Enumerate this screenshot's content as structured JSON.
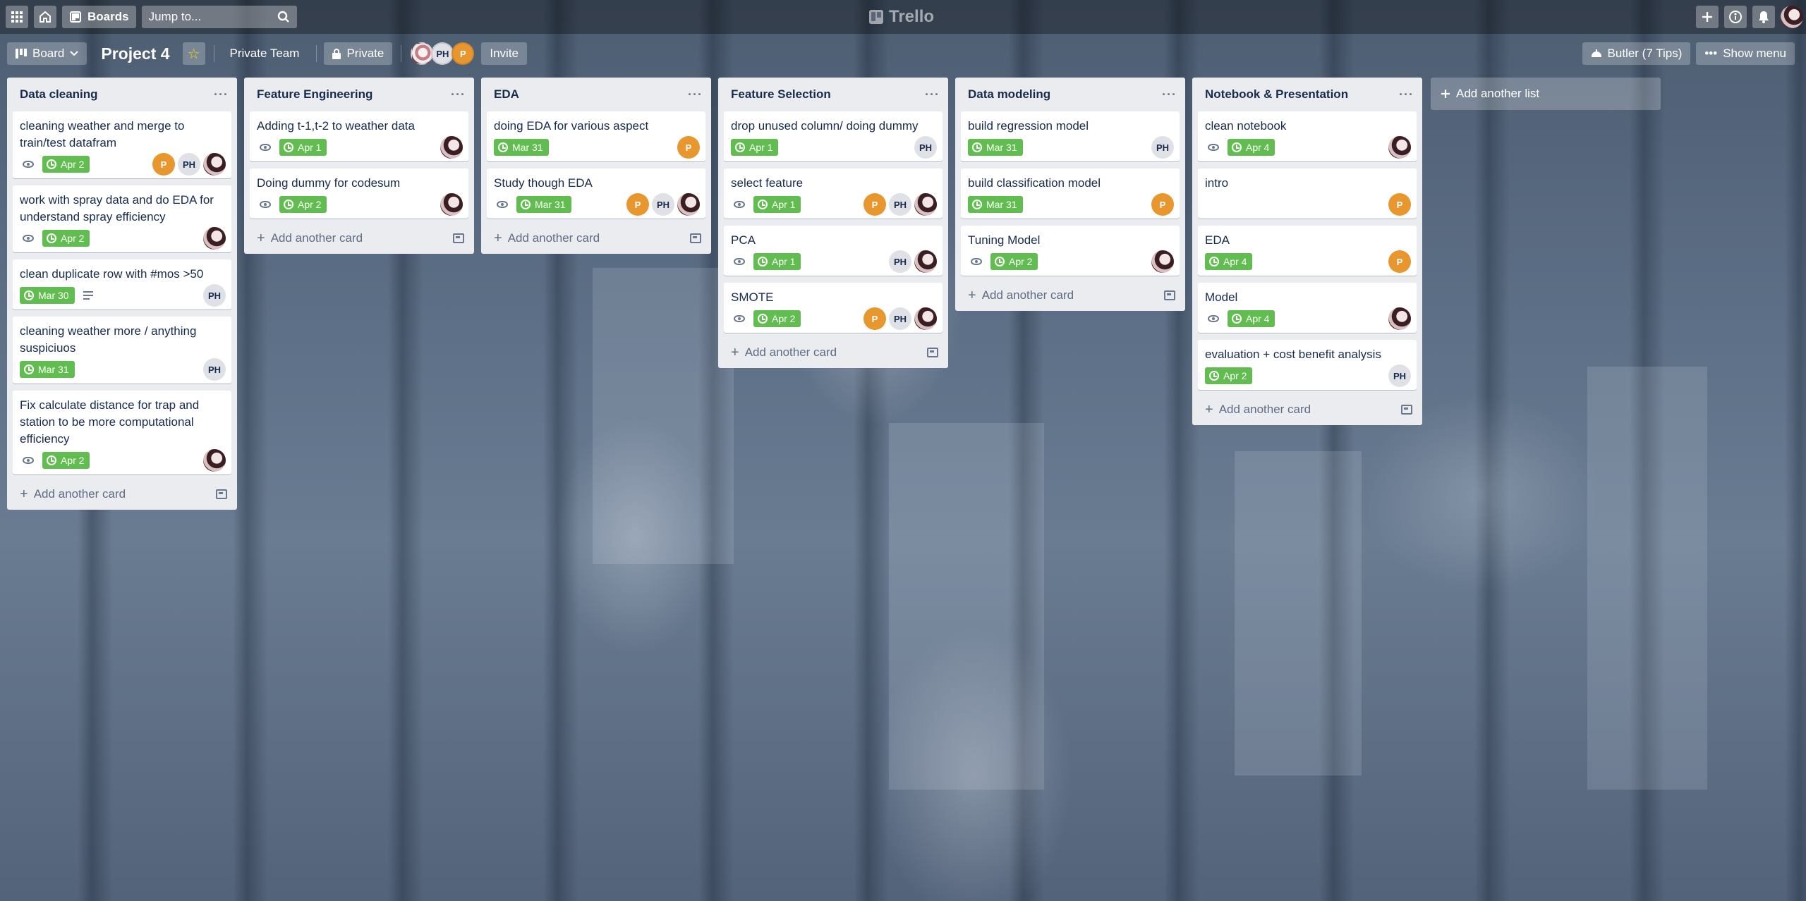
{
  "header": {
    "boards_label": "Boards",
    "search_placeholder": "Jump to...",
    "logo_text": "Trello"
  },
  "board": {
    "view_label": "Board",
    "title": "Project 4",
    "team_label": "Private Team",
    "visibility_label": "Private",
    "invite_label": "Invite",
    "butler_label": "Butler (7 Tips)",
    "menu_label": "Show menu",
    "members": [
      "PH",
      "P"
    ]
  },
  "lists": [
    {
      "title": "Data cleaning",
      "add_card": "Add another card",
      "cards": [
        {
          "title": "cleaning weather and merge to train/test datafram",
          "watch": true,
          "due": "Apr 2",
          "members": [
            "P",
            "PH",
            "img"
          ]
        },
        {
          "title": "work with spray data and do EDA for understand spray efficiency",
          "watch": true,
          "due": "Apr 2",
          "members": [
            "img"
          ]
        },
        {
          "title": "clean duplicate row with #mos >50",
          "watch": false,
          "due": "Mar 30",
          "desc": true,
          "members": [
            "PH"
          ]
        },
        {
          "title": "cleaning weather more / anything suspiciuos",
          "watch": false,
          "due": "Mar 31",
          "members": [
            "PH"
          ]
        },
        {
          "title": "Fix calculate distance for trap and station to be more computational efficiency",
          "watch": true,
          "due": "Apr 2",
          "members": [
            "img"
          ]
        }
      ]
    },
    {
      "title": "Feature Engineering",
      "add_card": "Add another card",
      "cards": [
        {
          "title": "Adding t-1,t-2 to weather data",
          "watch": true,
          "due": "Apr 1",
          "members": [
            "img"
          ]
        },
        {
          "title": "Doing dummy for codesum",
          "watch": true,
          "due": "Apr 2",
          "members": [
            "img"
          ]
        }
      ]
    },
    {
      "title": "EDA",
      "add_card": "Add another card",
      "cards": [
        {
          "title": "doing EDA for various aspect",
          "watch": false,
          "due": "Mar 31",
          "members": [
            "P"
          ]
        },
        {
          "title": "Study though EDA",
          "watch": true,
          "due": "Mar 31",
          "members": [
            "P",
            "PH",
            "img"
          ]
        }
      ]
    },
    {
      "title": "Feature Selection",
      "add_card": "Add another card",
      "cards": [
        {
          "title": "drop unused column/ doing dummy",
          "watch": false,
          "due": "Apr 1",
          "members": [
            "PH"
          ]
        },
        {
          "title": "select feature",
          "watch": true,
          "due": "Apr 1",
          "members": [
            "P",
            "PH",
            "img"
          ]
        },
        {
          "title": "PCA",
          "watch": true,
          "due": "Apr 1",
          "members": [
            "PH",
            "img"
          ]
        },
        {
          "title": "SMOTE",
          "watch": true,
          "due": "Apr 2",
          "members": [
            "P",
            "PH",
            "img"
          ]
        }
      ]
    },
    {
      "title": "Data modeling",
      "add_card": "Add another card",
      "cards": [
        {
          "title": "build regression model",
          "watch": false,
          "due": "Mar 31",
          "members": [
            "PH"
          ]
        },
        {
          "title": "build classification model",
          "watch": false,
          "due": "Mar 31",
          "members": [
            "P"
          ]
        },
        {
          "title": "Tuning Model",
          "watch": true,
          "due": "Apr 2",
          "members": [
            "img"
          ]
        }
      ]
    },
    {
      "title": "Notebook & Presentation",
      "add_card": "Add another card",
      "cards": [
        {
          "title": "clean notebook",
          "watch": true,
          "due": "Apr 4",
          "members": [
            "img"
          ]
        },
        {
          "title": "intro",
          "watch": false,
          "due": "",
          "members": [
            "P"
          ]
        },
        {
          "title": "EDA",
          "watch": false,
          "due": "Apr 4",
          "members": [
            "P"
          ]
        },
        {
          "title": "Model",
          "watch": true,
          "due": "Apr 4",
          "members": [
            "img"
          ]
        },
        {
          "title": "evaluation + cost benefit analysis",
          "watch": false,
          "due": "Apr 2",
          "members": [
            "PH"
          ]
        }
      ]
    }
  ],
  "add_list_label": "Add another list",
  "colors": {
    "due_green": "#61bd4f",
    "avatar_orange": "#e8962e",
    "list_bg": "#ebecf0"
  }
}
